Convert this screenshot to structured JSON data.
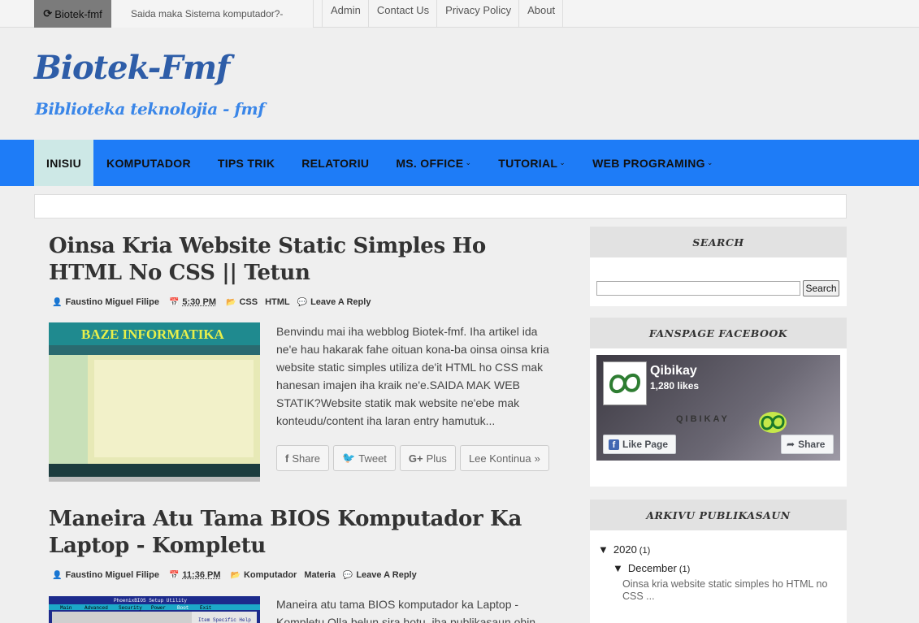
{
  "topbar": {
    "brand_label": "Biotek-fmf",
    "brand_icon": "refresh-icon",
    "ticker_text": "Saida maka Sistema komputador?-",
    "links": [
      {
        "label": "Admin"
      },
      {
        "label": "Contact Us"
      },
      {
        "label": "Privacy Policy"
      },
      {
        "label": "About"
      }
    ]
  },
  "header": {
    "title": "Biotek-Fmf",
    "description": "Biblioteka teknolojia - fmf"
  },
  "nav": {
    "items": [
      {
        "label": "INISIU",
        "active": true,
        "dropdown": false
      },
      {
        "label": "KOMPUTADOR",
        "dropdown": false
      },
      {
        "label": "TIPS TRIK",
        "dropdown": false
      },
      {
        "label": "RELATORIU",
        "dropdown": false
      },
      {
        "label": "MS. OFFICE",
        "dropdown": true
      },
      {
        "label": "TUTORIAL",
        "dropdown": true
      },
      {
        "label": "WEB PROGRAMING",
        "dropdown": true
      }
    ],
    "caret": "⌄"
  },
  "posts": [
    {
      "title": "Oinsa Kria Website Static Simples Ho HTML No CSS || Tetun",
      "author": "Faustino Miguel Filipe",
      "time": "5:30 PM",
      "categories": [
        "CSS",
        "HTML"
      ],
      "comments": "Leave A Reply",
      "thumb_caption": "BAZE INFORMATIKA",
      "excerpt": " Benvindu mai iha webblog Biotek-fmf. Iha artikel ida ne'e hau hakarak fahe oituan kona-ba oinsa oinsa kria website static simples utiliza de'it HTML ho CSS mak hanesan imajen iha kraik ne'e.SAIDA MAK WEB STATIK?Website statik mak website ne'ebe mak konteudu/content iha laran entry hamutuk...",
      "buttons": {
        "share": "Share",
        "tweet": "Tweet",
        "plus": "Plus",
        "plus_prefix": "G+",
        "more": "Lee Kontinua"
      }
    },
    {
      "title": "Maneira Atu Tama BIOS Komputador Ka Laptop - Kompletu",
      "author": "Faustino Miguel Filipe",
      "time": "11:36 PM",
      "categories": [
        "Komputador",
        "Materia"
      ],
      "comments": "Leave A Reply",
      "thumb_caption": "PhoenixBIOS Setup Utility",
      "thumb_menu": [
        "Main",
        "Advanced",
        "Security",
        "Power",
        "Boot",
        "Exit"
      ],
      "thumb_help": "Item Specific Help",
      "excerpt": "Maneira atu tama BIOS komputador ka Laptop - Kompletu Olla belun sira hotu, iha publikasaun ohin"
    }
  ],
  "sidebar": {
    "search": {
      "heading": "SEARCH",
      "button": "Search",
      "placeholder": ""
    },
    "facebook": {
      "heading": "FANSPAGE FACEBOOK",
      "page_name": "Qibikay",
      "likes": "1,280 likes",
      "wordmark": "QIBIKAY",
      "like_button": "Like Page",
      "share_button": "Share"
    },
    "archive": {
      "heading": "ARKIVU PUBLIKASAUN",
      "year": "2020",
      "year_count": "(1)",
      "month": "December",
      "month_count": "(1)",
      "post_link": "Oinsa kria website static simples ho HTML no CSS ...",
      "toggle": "▼"
    }
  },
  "colors": {
    "nav_bg": "#1e7cf7",
    "nav_active_bg": "#cde8e6",
    "title_blue": "#2e5da8",
    "desc_blue": "#3a86e8",
    "fb_blue": "#4267b2"
  }
}
